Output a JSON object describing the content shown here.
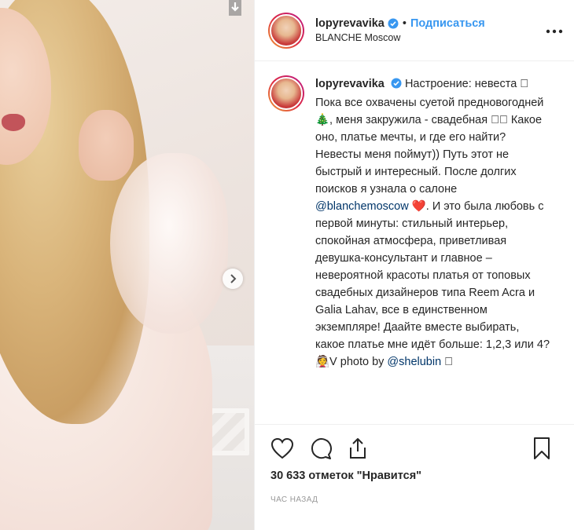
{
  "post": {
    "username": "lopyrevavika",
    "follow_label": "Подписаться",
    "location": "BLANCHE Moscow",
    "separator": "•"
  },
  "caption": {
    "username": "lopyrevavika",
    "text_before_mention": "Настроение: невеста 🏻 Пока все охвачены суетой предновогодней 🎄, меня закружила - свадебная 🏻🏻 Какое оно, платье мечты, и где его найти? Невесты меня поймут)) Путь этот не быстрый и интересный. После долгих поисков я узнала о салоне",
    "mention": "@blanchemoscow",
    "text_after_mention": "❤️. И это была любовь с первой минуты: стильный интерьер, спокойная атмосфера, приветливая девушка-консультант и главное – невероятной красоты платья от топовых свадебных дизайнеров типа Reem Acra и Galia Lahav, все в единственном экземпляре! Даайте вместе выбирать, какое платье мне идёт больше: 1,2,3 или 4? 👰V photo by",
    "mention2": "@shelubin",
    "tail": "🏻"
  },
  "likes_text": "30 633 отметок \"Нравится\"",
  "timestamp": "ЧАС НАЗАД",
  "colors": {
    "link": "#3897f0",
    "mention": "#003569",
    "text": "#262626",
    "muted": "#999999",
    "border": "#efefef"
  },
  "icons": [
    "download-icon",
    "next-arrow-icon",
    "verified-badge-icon",
    "more-options-icon",
    "heart-icon",
    "comment-icon",
    "share-icon",
    "bookmark-icon"
  ]
}
